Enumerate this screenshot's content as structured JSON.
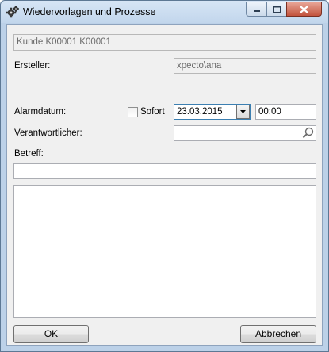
{
  "window": {
    "title": "Wiedervorlagen und Prozesse",
    "icon": "gear-icon"
  },
  "form": {
    "customer_value": "Kunde K00001 K00001",
    "creator_label": "Ersteller:",
    "creator_value": "xpecto\\ana",
    "alarm_label": "Alarmdatum:",
    "sofort_label": "Sofort",
    "sofort_checked": false,
    "date_value": "23.03.2015",
    "time_value": "00:00",
    "responsible_label": "Verantwortlicher:",
    "responsible_value": "",
    "subject_label": "Betreff:",
    "subject_value": "",
    "body_value": ""
  },
  "buttons": {
    "ok_label": "OK",
    "cancel_label": "Abbrechen"
  }
}
